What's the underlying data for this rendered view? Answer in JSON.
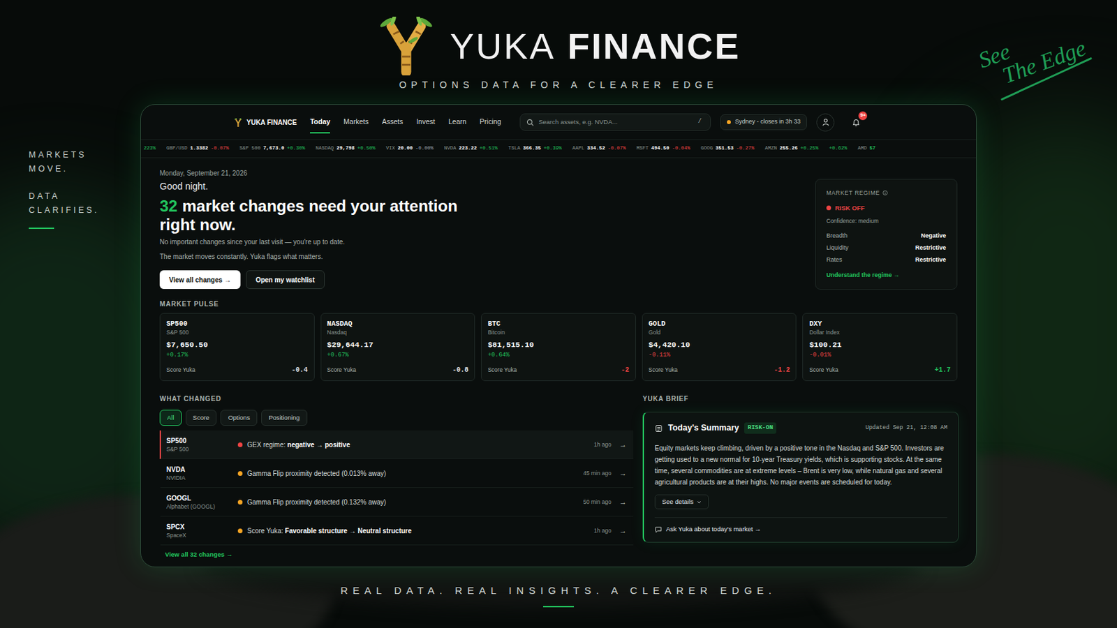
{
  "brand": {
    "name_light": "YUKA",
    "name_bold": "FINANCE",
    "tagline": "OPTIONS DATA FOR A CLEARER EDGE"
  },
  "side_text": {
    "top": [
      "MARKETS",
      "MOVE."
    ],
    "bottom": [
      "DATA",
      "CLARIFIES."
    ]
  },
  "script_text": [
    "See",
    "The Edge"
  ],
  "footer_tagline": "REAL DATA. REAL INSIGHTS. A CLEARER EDGE.",
  "app": {
    "nav": {
      "logo": "YUKA FINANCE",
      "tabs": [
        {
          "label": "Today",
          "selected": true
        },
        {
          "label": "Markets",
          "selected": false
        },
        {
          "label": "Assets",
          "selected": false
        },
        {
          "label": "Invest",
          "selected": false
        },
        {
          "label": "Learn",
          "selected": false
        },
        {
          "label": "Pricing",
          "selected": false
        }
      ],
      "search": {
        "placeholder": "Search assets, e.g. NVDA...",
        "shortcut": "/"
      },
      "market_status": {
        "label": "Sydney - closes in 3h 33",
        "color": "#f5a524"
      },
      "notifications": {
        "badge": "9+"
      }
    },
    "ticker": [
      {
        "change": "223%",
        "color": "#22c55e"
      },
      {
        "symbol": "GBP/USD",
        "price": "1.3382",
        "change": "-0.07%",
        "color": "#ef4444"
      },
      {
        "symbol": "S&P 500",
        "price": "7,673.0",
        "change": "+0.30%",
        "color": "#22c55e"
      },
      {
        "symbol": "NASDAQ",
        "price": "29,798",
        "change": "+0.50%",
        "color": "#22c55e"
      },
      {
        "symbol": "VIX",
        "price": "20.00",
        "change": "-0.00%",
        "color": "#9ca3af"
      },
      {
        "symbol": "NVDA",
        "price": "223.22",
        "change": "+0.51%",
        "color": "#22c55e"
      },
      {
        "symbol": "TSLA",
        "price": "366.35",
        "change": "+0.39%",
        "color": "#22c55e"
      },
      {
        "symbol": "AAPL",
        "price": "334.52",
        "change": "-0.07%",
        "color": "#ef4444"
      },
      {
        "symbol": "MSFT",
        "price": "494.50",
        "change": "-0.04%",
        "color": "#ef4444"
      },
      {
        "symbol": "GOOG",
        "price": "351.53",
        "change": "-0.27%",
        "color": "#ef4444"
      },
      {
        "symbol": "AMZN",
        "price": "255.26",
        "change": "+0.25%",
        "color": "#22c55e"
      },
      {
        "change": "+0.62%",
        "color": "#22c55e"
      },
      {
        "symbol": "AMD",
        "price": "57",
        "color": "#22c55e"
      }
    ],
    "hero": {
      "date": "Monday, September 21, 2026",
      "greeting": "Good night.",
      "count": "32",
      "headline_line1": "market changes need your attention",
      "headline_line2": "right now.",
      "subtitle": "No important changes since your last visit — you're up to date.",
      "note": "The market moves constantly. Yuka flags what matters.",
      "primary_button": "View all changes →",
      "secondary_button": "Open my watchlist"
    },
    "regime": {
      "title": "MARKET REGIME",
      "status": "RISK OFF",
      "status_color": "#ef4444",
      "confidence": "Confidence: medium",
      "rows": [
        {
          "label": "Breadth",
          "value": "Negative"
        },
        {
          "label": "Liquidity",
          "value": "Restrictive"
        },
        {
          "label": "Rates",
          "value": "Restrictive"
        }
      ],
      "link": "Understand the regime →"
    },
    "market_pulse": {
      "title": "MARKET PULSE",
      "cards": [
        {
          "symbol": "SP500",
          "name": "S&P 500",
          "price": "$7,650.50",
          "change": "+0.17%",
          "change_color": "#22c55e",
          "score_label": "Score Yuka",
          "score": "-0.4",
          "score_color": "#e5e7eb"
        },
        {
          "symbol": "NASDAQ",
          "name": "Nasdaq",
          "price": "$29,644.17",
          "change": "+0.67%",
          "change_color": "#22c55e",
          "score_label": "Score Yuka",
          "score": "-0.8",
          "score_color": "#e5e7eb"
        },
        {
          "symbol": "BTC",
          "name": "Bitcoin",
          "price": "$81,515.10",
          "change": "+0.64%",
          "change_color": "#22c55e",
          "score_label": "Score Yuka",
          "score": "-2",
          "score_color": "#ef4444"
        },
        {
          "symbol": "GOLD",
          "name": "Gold",
          "price": "$4,420.10",
          "change": "-0.11%",
          "change_color": "#ef4444",
          "score_label": "Score Yuka",
          "score": "-1.2",
          "score_color": "#ef4444"
        },
        {
          "symbol": "DXY",
          "name": "Dollar Index",
          "price": "$100.21",
          "change": "-0.01%",
          "change_color": "#ef4444",
          "score_label": "Score Yuka",
          "score": "+1.7",
          "score_color": "#22c55e"
        }
      ]
    },
    "what_changed": {
      "title": "WHAT CHANGED",
      "filters": [
        {
          "label": "All",
          "selected": true
        },
        {
          "label": "Score",
          "selected": false
        },
        {
          "label": "Options",
          "selected": false
        },
        {
          "label": "Positioning",
          "selected": false
        }
      ],
      "rows": [
        {
          "symbol": "SP500",
          "name": "S&P 500",
          "color": "#ef4444",
          "highlighted": true,
          "parts": [
            {
              "text": "GEX regime: ",
              "bold": false
            },
            {
              "text": "negative → positive",
              "bold": true
            }
          ],
          "time": "1h ago",
          "arrow": "→"
        },
        {
          "symbol": "NVDA",
          "name": "NVIDIA",
          "color": "#f5a524",
          "highlighted": false,
          "parts": [
            {
              "text": "Gamma Flip proximity detected (0.013% away)",
              "bold": false
            }
          ],
          "time": "45 min ago",
          "arrow": "→"
        },
        {
          "symbol": "GOOGL",
          "name": "Alphabet (GOOGL)",
          "color": "#f5a524",
          "highlighted": false,
          "parts": [
            {
              "text": "Gamma Flip proximity detected (0.132% away)",
              "bold": false
            }
          ],
          "time": "50 min ago",
          "arrow": "→"
        },
        {
          "symbol": "SPCX",
          "name": "SpaceX",
          "color": "#f5a524",
          "highlighted": false,
          "parts": [
            {
              "text": "Score Yuka: ",
              "bold": false
            },
            {
              "text": "Favorable structure → Neutral structure",
              "bold": true
            }
          ],
          "time": "1h ago",
          "arrow": "→"
        }
      ],
      "view_all": "View all 32 changes →"
    },
    "brief": {
      "title": "YUKA BRIEF",
      "card_title": "Today's Summary",
      "badge": "RISK-ON",
      "updated": "Updated Sep 21, 12:08 AM",
      "text": "Equity markets keep climbing, driven by a positive tone in the Nasdaq and S&P 500. Investors are getting used to a new normal for 10-year Treasury yields, which is supporting stocks. At the same time, several commodities are at extreme levels – Brent is very low, while natural gas and several agricultural products are at their highs. No major events are scheduled for today.",
      "details_button": "See details",
      "ask_link": "Ask Yuka about today's market →"
    }
  }
}
